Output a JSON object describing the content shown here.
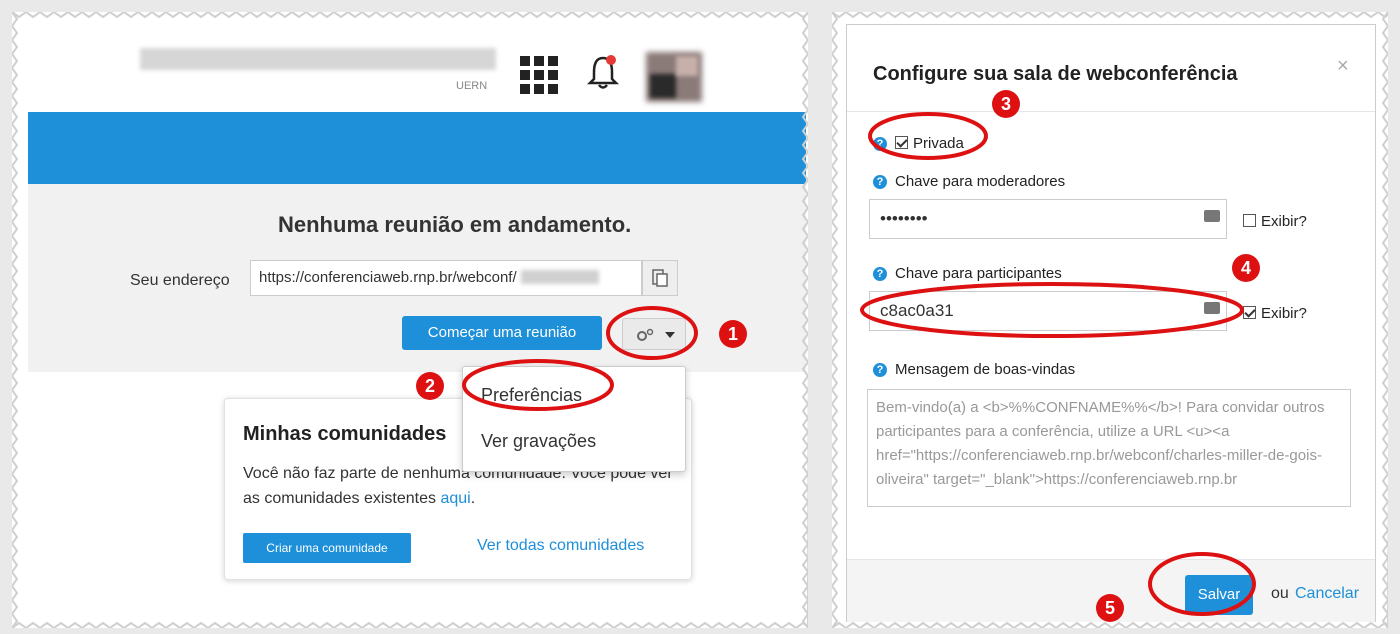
{
  "left": {
    "org_label": "UERN",
    "banner_color": "#1e8fd9",
    "status_heading": "Nenhuma reunião em andamento.",
    "address_label": "Seu endereço",
    "address_value": "https://conferenciaweb.rnp.br/webconf/",
    "start_meeting_button": "Começar uma reunião",
    "menu": {
      "preferences": "Preferências",
      "recordings": "Ver gravações"
    },
    "communities": {
      "title": "Minhas comunidades",
      "text": "Você não faz parte de nenhuma comunidade. Você pode ver as comunidades existentes",
      "link": "aqui",
      "period": ".",
      "create_button": "Criar uma comunidade",
      "see_all_link": "Ver todas comunidades"
    }
  },
  "dialog": {
    "title": "Configure sua sala de webconferência",
    "close": "×",
    "private_label": "Privada",
    "private_checked": true,
    "moderator_key_label": "Chave para moderadores",
    "moderator_key_value": "••••••••",
    "show_label_1": "Exibir?",
    "show_1_checked": false,
    "participant_key_label": "Chave para participantes",
    "participant_key_value": "c8ac0a31",
    "show_label_2": "Exibir?",
    "show_2_checked": true,
    "welcome_label": "Mensagem de boas-vindas",
    "welcome_value": "Bem-vindo(a) a <b>%%CONFNAME%%</b>! Para convidar outros participantes para a conferência, utilize a URL <u><a href=\"https://conferenciaweb.rnp.br/webconf/charles-miller-de-gois-oliveira\" target=\"_blank\">https://conferenciaweb.rnp.br",
    "save_button": "Salvar",
    "or_text": "ou",
    "cancel_link": "Cancelar"
  },
  "annotations": [
    "1",
    "2",
    "3",
    "4",
    "5"
  ],
  "annotation_color": "#dd1111"
}
